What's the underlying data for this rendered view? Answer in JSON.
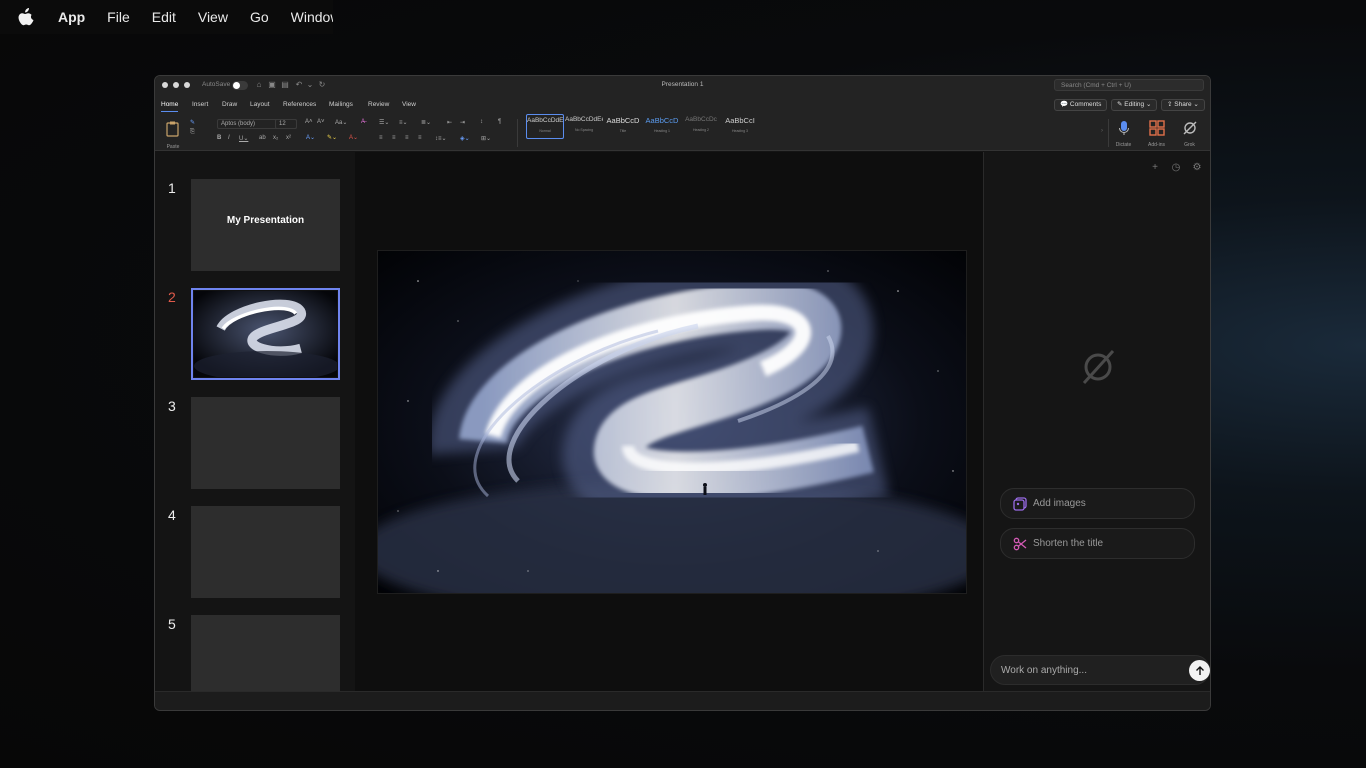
{
  "menubar": {
    "items": [
      "App",
      "File",
      "Edit",
      "View",
      "Go",
      "Window"
    ]
  },
  "window": {
    "title": "Presentation 1",
    "autosave_label": "AutoSave",
    "search_placeholder": "Search (Cmd + Ctrl + U)"
  },
  "tabs": [
    "Home",
    "Insert",
    "Draw",
    "Layout",
    "References",
    "Mailings",
    "Review",
    "View"
  ],
  "ribbon": {
    "comments_label": "Comments",
    "editing_label": "Editing",
    "share_label": "Share",
    "paste_label": "Paste",
    "font_name": "Aptos (body)",
    "font_size": "12",
    "styles": [
      {
        "sample": "AaBbCcDdEe",
        "name": "Normal"
      },
      {
        "sample": "AaBbCcDdEe",
        "name": "No Spacing"
      },
      {
        "sample": "AaBbCcD",
        "name": "Title"
      },
      {
        "sample": "AaBbCcD",
        "name": "Heading 1"
      },
      {
        "sample": "AaBbCcDc",
        "name": "Heading 2"
      },
      {
        "sample": "AaBbCcI",
        "name": "Heading 3"
      }
    ],
    "dictate_label": "Dictate",
    "addins_label": "Add-ins",
    "grok_label": "Grok"
  },
  "slides": [
    {
      "number": "1",
      "title": "My Presentation"
    },
    {
      "number": "2",
      "title": ""
    },
    {
      "number": "3",
      "title": ""
    },
    {
      "number": "4",
      "title": ""
    },
    {
      "number": "5",
      "title": ""
    }
  ],
  "copilot": {
    "suggestions": [
      "Add images",
      "Shorten the title"
    ],
    "chat_placeholder": "Work on anything..."
  },
  "colors": {
    "accent": "#5b8def",
    "selected_slide_border": "#6f84ef",
    "selected_slide_number": "#e05a4a"
  }
}
